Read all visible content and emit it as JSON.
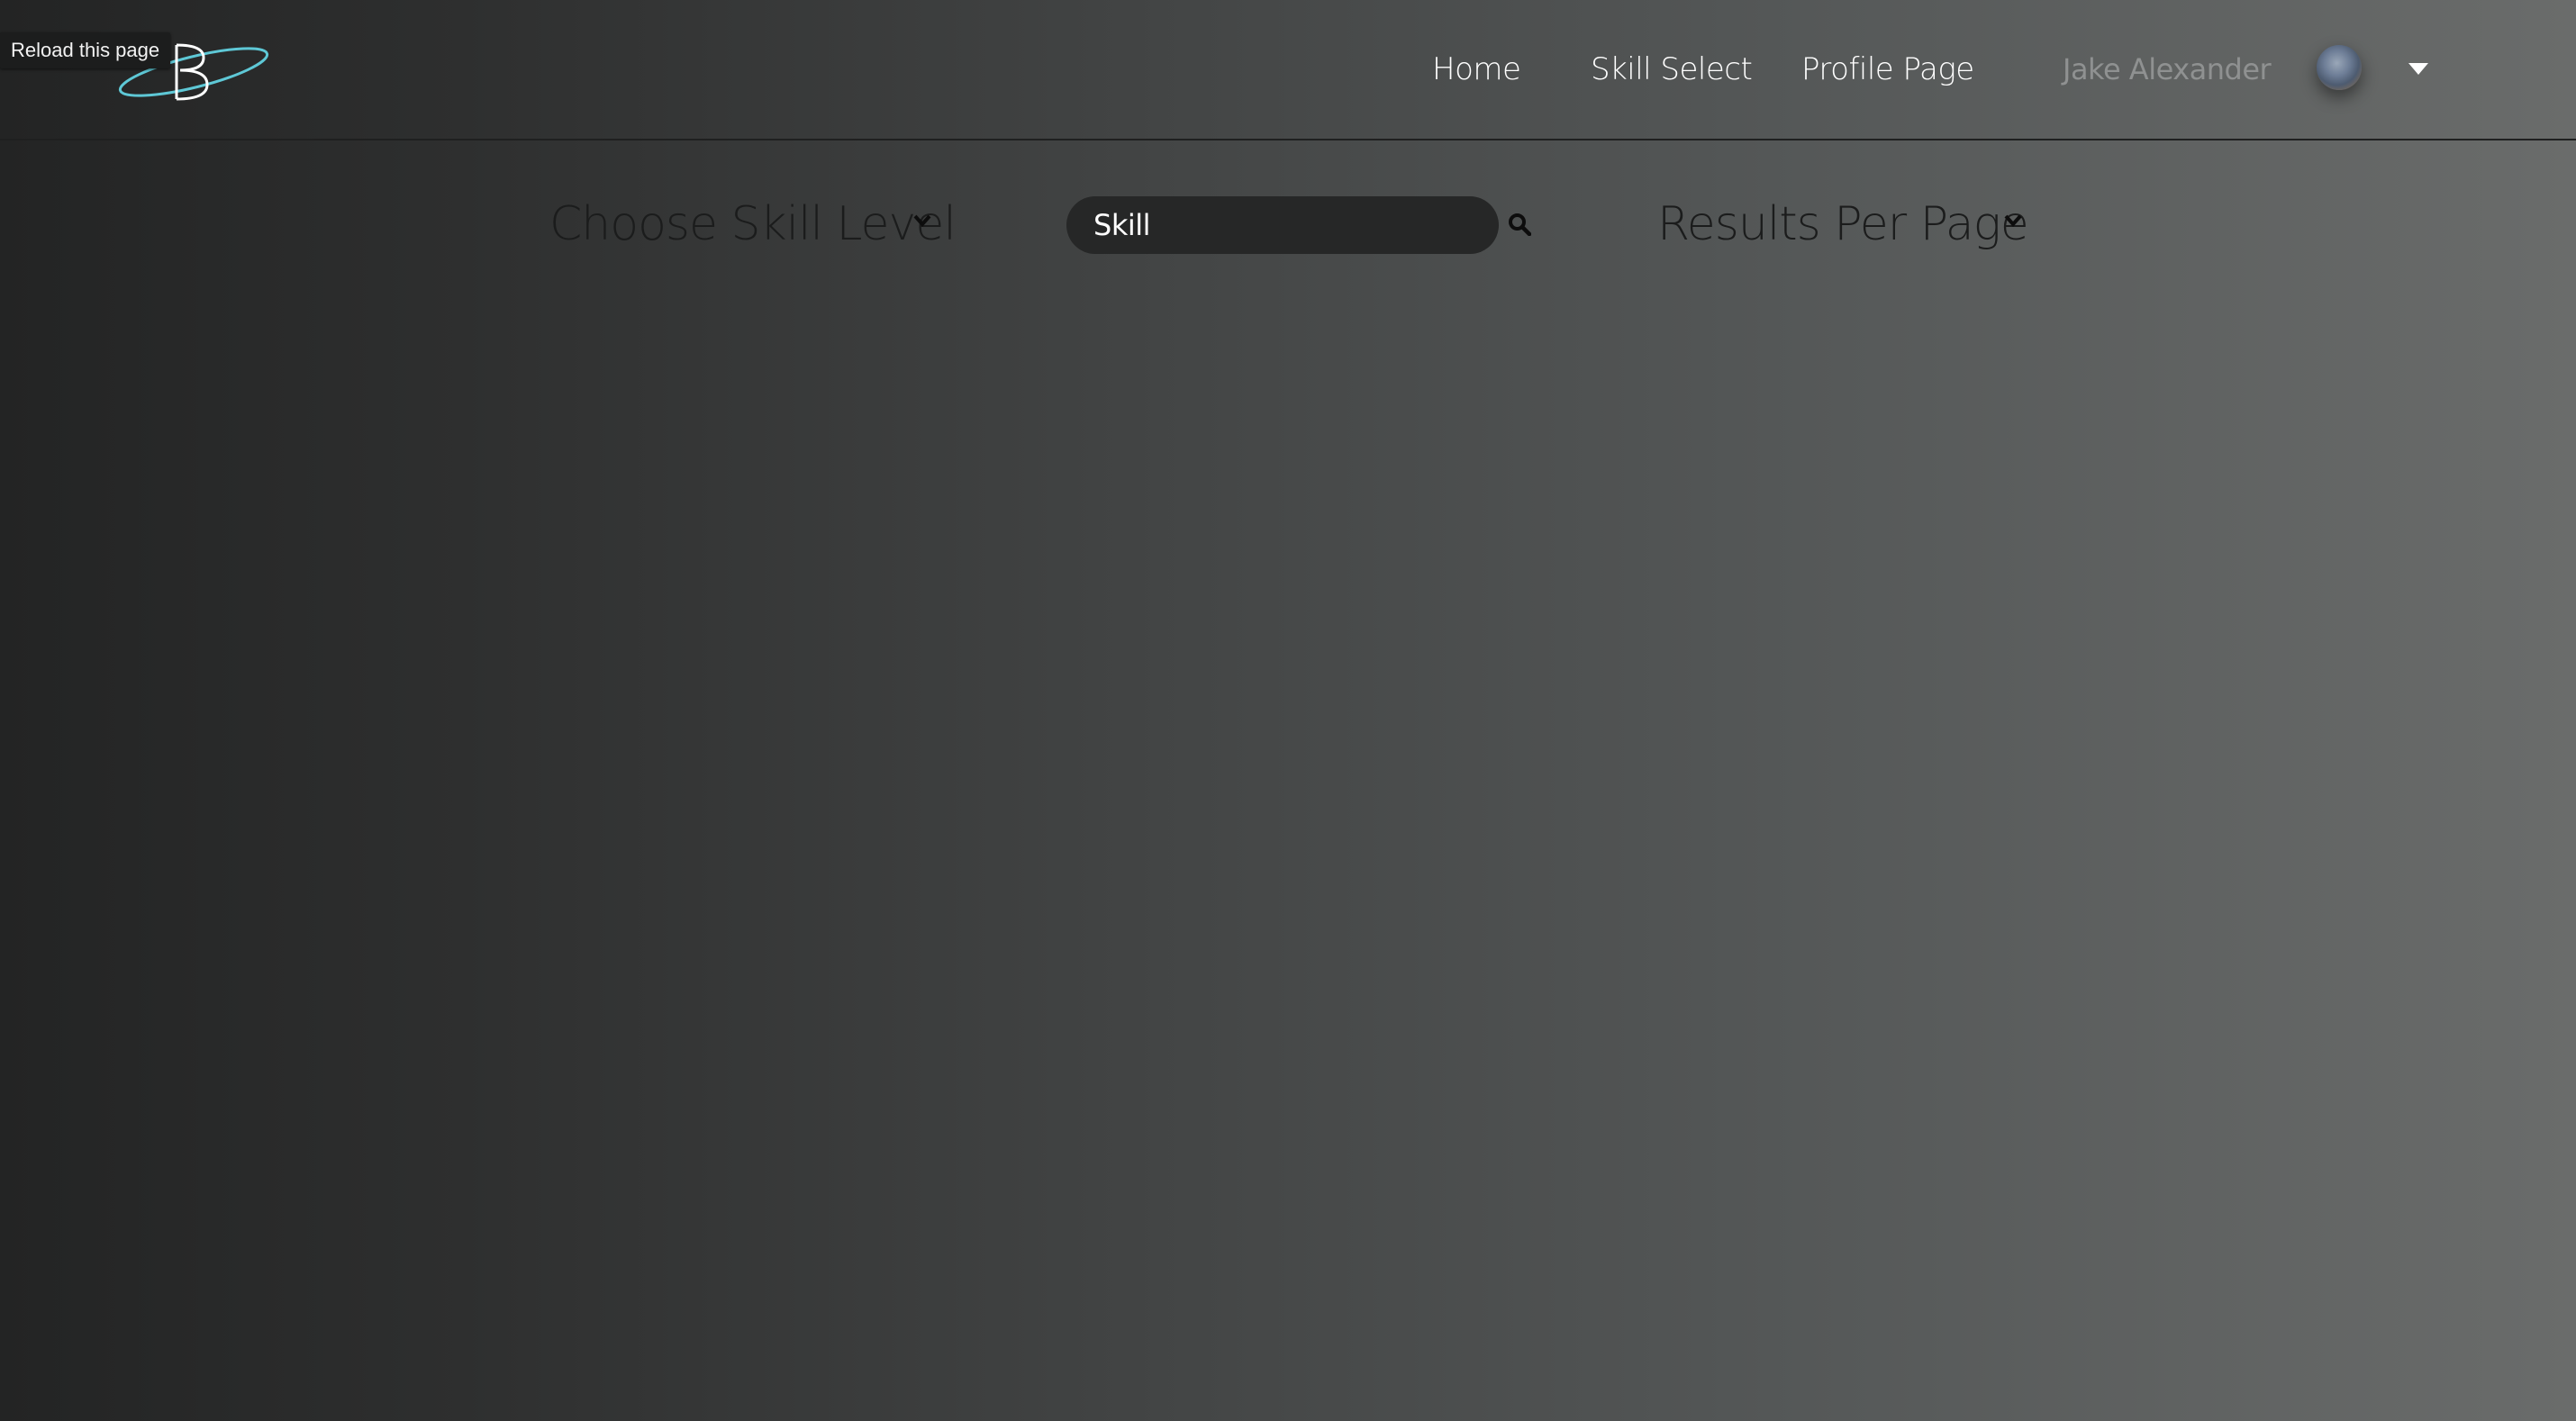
{
  "tooltip": {
    "text": "Reload this page"
  },
  "header": {
    "logo_icon": "b-orbit-logo",
    "nav": {
      "home": "Home",
      "skill_select": "Skill Select",
      "profile_page": "Profile Page"
    },
    "user": {
      "name": "Jake Alexander",
      "avatar_icon": "user-avatar",
      "menu_icon": "caret-down-icon"
    }
  },
  "filters": {
    "skill_level": {
      "label": "Choose Skill Level",
      "icon": "chevron-down-icon"
    },
    "search": {
      "placeholder": "Skill",
      "value": "",
      "icon": "search-icon"
    },
    "results_per_page": {
      "label": "Results Per Page",
      "icon": "chevron-down-icon"
    }
  },
  "colors": {
    "logo_accent": "#5ec8d6",
    "nav_text": "#ffffff",
    "user_name": "#8f9191",
    "filter_label": "#1b1c1c",
    "search_bg": "#262727"
  }
}
